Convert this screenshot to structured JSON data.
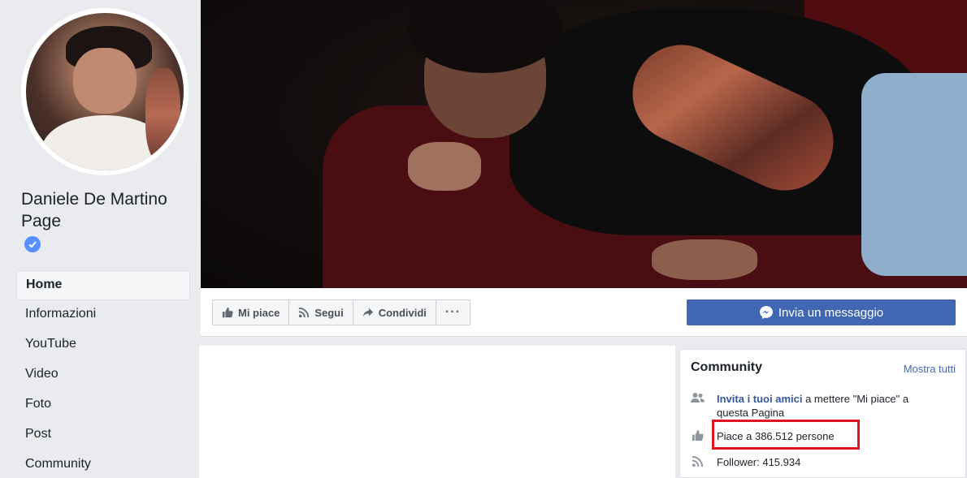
{
  "page": {
    "name": "Daniele De Martino Page",
    "verified_icon": "verified-badge-icon"
  },
  "nav": {
    "items": [
      {
        "label": "Home",
        "active": true
      },
      {
        "label": "Informazioni"
      },
      {
        "label": "YouTube"
      },
      {
        "label": "Video"
      },
      {
        "label": "Foto"
      },
      {
        "label": "Post"
      },
      {
        "label": "Community"
      }
    ]
  },
  "actions": {
    "like_label": "Mi piace",
    "follow_label": "Segui",
    "share_label": "Condividi",
    "more_label": "···",
    "message_label": "Invia un messaggio"
  },
  "community": {
    "title": "Community",
    "see_all": "Mostra tutti",
    "invite_link": "Invita i tuoi amici",
    "invite_rest": " a mettere \"Mi piace\" a questa Pagina",
    "likes": "Piace a 386.512 persone",
    "followers": "Follower: 415.934"
  },
  "colors": {
    "accent": "#4267b2",
    "highlight": "#e0141f"
  }
}
